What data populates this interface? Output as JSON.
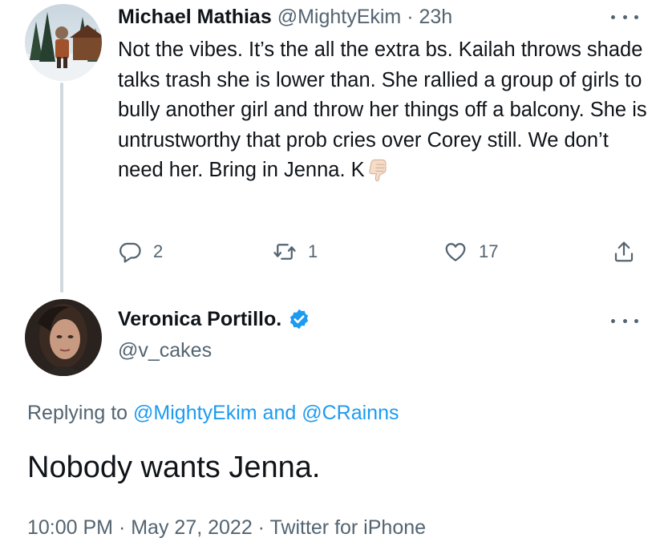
{
  "tweet1": {
    "author_name": "Michael Mathias",
    "handle": "@MightyEkim",
    "separator": " · ",
    "time": "23h",
    "text": "Not the vibes. It’s the all the extra bs. Kailah throws shade talks trash she is lower than. She rallied a group of girls to bully another girl and throw her things off a balcony. She is untrustworthy that prob cries over Corey still. We don’t need her. Bring in Jenna. K",
    "emoji": "thumbs-down-emoji",
    "replies": "2",
    "retweets": "1",
    "likes": "17"
  },
  "tweet2": {
    "author_name": "Veronica Portillo.",
    "handle": "@v_cakes",
    "replying_prefix": "Replying to ",
    "reply_to_1": "@MightyEkim",
    "reply_and": " and ",
    "reply_to_2": "@CRainns",
    "text": "Nobody wants Jenna.",
    "time": "10:00 PM",
    "dot1": " · ",
    "date": "May 27, 2022",
    "dot2": " · ",
    "client": "Twitter for iPhone"
  },
  "icons": {
    "more": "more-horizontal-icon",
    "reply": "reply-bubble-icon",
    "retweet": "retweet-icon",
    "like": "heart-icon",
    "share": "share-icon",
    "verified": "verified-badge-icon"
  },
  "colors": {
    "text": "#0f1419",
    "muted": "#536471",
    "link": "#1d9bf0",
    "thread_line": "#cfd9de",
    "verified": "#1d9bf0"
  }
}
